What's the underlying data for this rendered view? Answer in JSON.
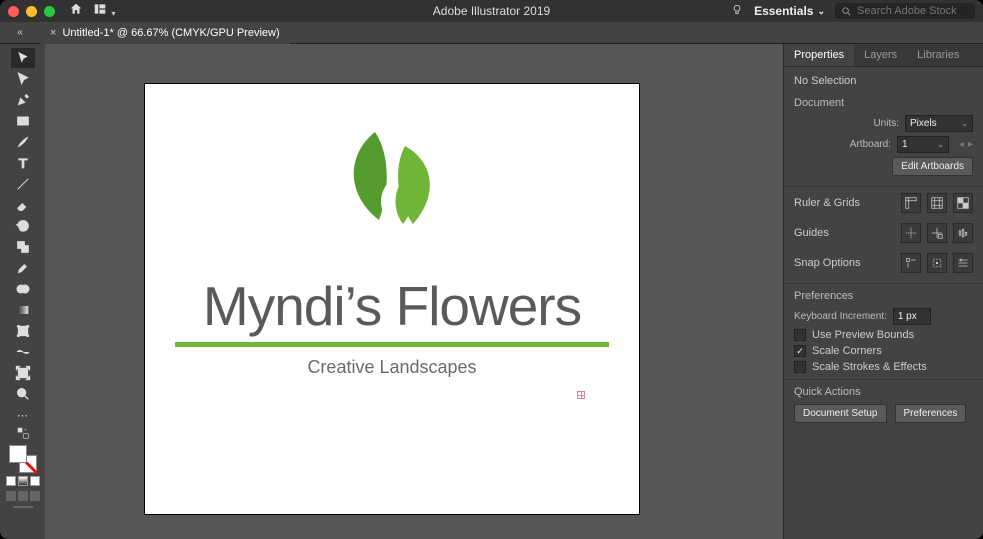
{
  "app": {
    "title": "Adobe Illustrator 2019",
    "workspace": "Essentials",
    "search_placeholder": "Search Adobe Stock"
  },
  "document_tab": {
    "label": "Untitled-1* @ 66.67% (CMYK/GPU Preview)"
  },
  "canvas": {
    "logo_title": "Myndi’s Flowers",
    "logo_subtitle": "Creative Landscapes"
  },
  "panel": {
    "tabs": {
      "properties": "Properties",
      "layers": "Layers",
      "libraries": "Libraries"
    },
    "selection": "No Selection",
    "document_section": "Document",
    "units_label": "Units:",
    "units_value": "Pixels",
    "artboard_label": "Artboard:",
    "artboard_value": "1",
    "edit_artboards": "Edit Artboards",
    "ruler_grids": "Ruler & Grids",
    "guides": "Guides",
    "snap_options": "Snap Options",
    "preferences_section": "Preferences",
    "keyboard_increment_label": "Keyboard Increment:",
    "keyboard_increment_value": "1 px",
    "use_preview_bounds": "Use Preview Bounds",
    "scale_corners": "Scale Corners",
    "scale_strokes": "Scale Strokes & Effects",
    "quick_actions": "Quick Actions",
    "document_setup": "Document Setup",
    "preferences_btn": "Preferences"
  },
  "tools": [
    "selection",
    "direct-selection",
    "pen",
    "curvature",
    "type",
    "line",
    "rectangle",
    "paintbrush",
    "shape-builder",
    "eraser",
    "rotate",
    "scale",
    "width",
    "gradient",
    "eyedropper",
    "free-transform",
    "artboard",
    "slice",
    "zoom"
  ]
}
